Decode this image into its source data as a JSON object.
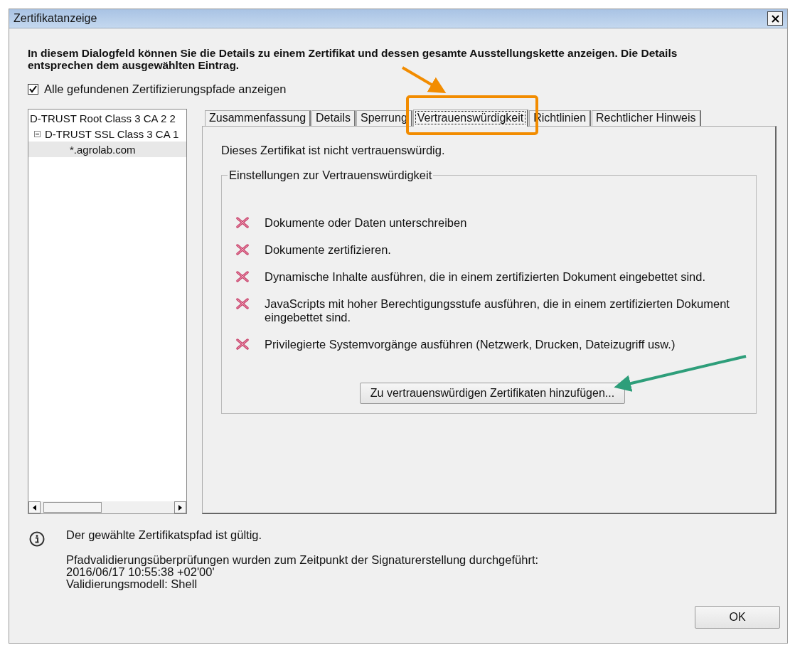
{
  "window": {
    "title": "Zertifikatanzeige"
  },
  "intro": "In diesem Dialogfeld können Sie die Details zu einem Zertifikat und dessen gesamte Ausstellungskette anzeigen. Die Details entsprechen dem ausgewählten Eintrag.",
  "show_all_paths": {
    "label": "Alle gefundenen Zertifizierungspfade anzeigen",
    "checked": true
  },
  "tree": [
    {
      "label": "D-TRUST Root Class 3 CA 2 2",
      "selected": false,
      "children": [
        {
          "label": "D-TRUST SSL Class 3 CA 1",
          "selected": false,
          "expanded": true,
          "children": [
            {
              "label": "*.agrolab.com",
              "selected": true
            }
          ]
        }
      ]
    }
  ],
  "tabs": [
    {
      "label": "Zusammenfassung",
      "selected": false
    },
    {
      "label": "Details",
      "selected": false
    },
    {
      "label": "Sperrung",
      "selected": false
    },
    {
      "label": "Vertrauenswürdigkeit",
      "selected": true
    },
    {
      "label": "Richtlinien",
      "selected": false
    },
    {
      "label": "Rechtlicher Hinweis",
      "selected": false
    }
  ],
  "trust_status": "Dieses Zertifikat ist nicht vertrauenswürdig.",
  "trust_settings": {
    "title": "Einstellungen zur Vertrauenswürdigkeit",
    "permissions": [
      {
        "label": "Dokumente oder Daten unterschreiben",
        "allowed": false
      },
      {
        "label": "Dokumente zertifizieren.",
        "allowed": false
      },
      {
        "label": "Dynamische Inhalte ausführen, die in einem zertifizierten Dokument eingebettet sind.",
        "allowed": false
      },
      {
        "label": "JavaScripts mit hoher Berechtigungsstufe ausführen, die in einem zertifizierten Dokument eingebettet sind.",
        "allowed": false
      },
      {
        "label": "Privilegierte Systemvorgänge ausführen (Netzwerk, Drucken, Dateizugriff usw.)",
        "allowed": false
      }
    ],
    "add_button": "Zu vertrauenswürdigen Zertifikaten hinzufügen..."
  },
  "validity": {
    "message": "Der gewählte Zertifikatspfad ist gültig.",
    "details": [
      "Pfadvalidierungsüberprüfungen wurden zum Zeitpunkt der Signaturerstellung durchgeführt:",
      "2016/06/17 10:55:38 +02'00'",
      "Validierungsmodell: Shell"
    ]
  },
  "ok_button": "OK"
}
